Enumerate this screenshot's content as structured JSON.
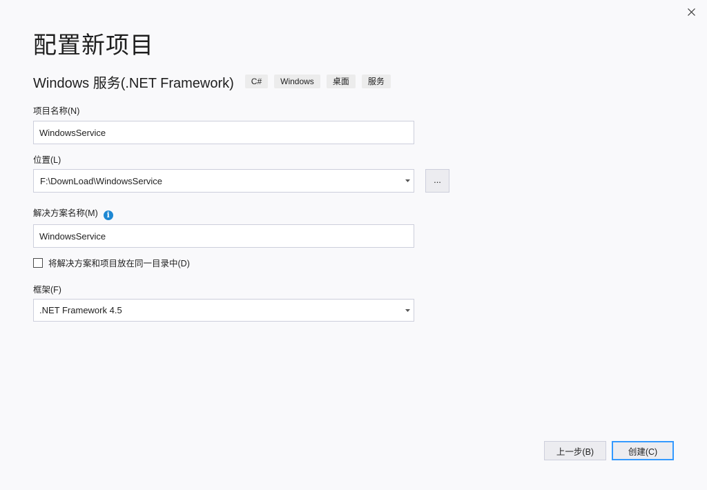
{
  "dialog": {
    "title": "配置新项目",
    "template_name": "Windows 服务(.NET Framework)",
    "tags": [
      "C#",
      "Windows",
      "桌面",
      "服务"
    ]
  },
  "project_name": {
    "label": "项目名称(N)",
    "value": "WindowsService"
  },
  "location": {
    "label": "位置(L)",
    "value": "F:\\DownLoad\\WindowsService",
    "browse_label": "..."
  },
  "solution_name": {
    "label": "解决方案名称(M)",
    "value": "WindowsService",
    "info_icon": "info-icon"
  },
  "same_directory": {
    "label": "将解决方案和项目放在同一目录中(D)",
    "checked": false
  },
  "framework": {
    "label": "框架(F)",
    "value": ".NET Framework 4.5"
  },
  "buttons": {
    "back": "上一步(B)",
    "create": "创建(C)"
  },
  "colors": {
    "accent": "#3399ff",
    "info": "#1e88d3",
    "background": "#f9f9fb"
  }
}
